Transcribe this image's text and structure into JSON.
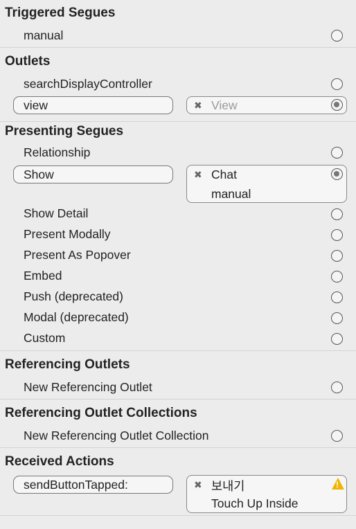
{
  "triggered_segues": {
    "title": "Triggered Segues",
    "items": [
      {
        "label": "manual"
      }
    ]
  },
  "outlets": {
    "title": "Outlets",
    "items": [
      {
        "label": "searchDisplayController"
      }
    ],
    "connected": {
      "label": "view",
      "target": "View",
      "remove_glyph": "✖"
    }
  },
  "presenting_segues": {
    "title": "Presenting Segues",
    "items": [
      {
        "label": "Relationship"
      }
    ],
    "connected": {
      "label": "Show",
      "target": "Chat",
      "detail": "manual",
      "remove_glyph": "✖"
    },
    "more_items": [
      {
        "label": "Show Detail"
      },
      {
        "label": "Present Modally"
      },
      {
        "label": "Present As Popover"
      },
      {
        "label": "Embed"
      },
      {
        "label": "Push (deprecated)"
      },
      {
        "label": "Modal (deprecated)"
      },
      {
        "label": "Custom"
      }
    ]
  },
  "referencing_outlets": {
    "title": "Referencing Outlets",
    "items": [
      {
        "label": "New Referencing Outlet"
      }
    ]
  },
  "referencing_outlet_collections": {
    "title": "Referencing Outlet Collections",
    "items": [
      {
        "label": "New Referencing Outlet Collection"
      }
    ]
  },
  "received_actions": {
    "title": "Received Actions",
    "connected": {
      "label": "sendButtonTapped:",
      "target": "보내기",
      "detail": "Touch Up Inside",
      "remove_glyph": "✖",
      "warning": "!"
    }
  },
  "colors": {
    "background": "#ececec",
    "warning": "#f0b400",
    "divider": "#d3d3d3"
  },
  "icons": {
    "connection": "circle-icon",
    "connected": "filled-circle-icon",
    "remove": "x-icon",
    "warning": "warning-triangle-icon"
  }
}
